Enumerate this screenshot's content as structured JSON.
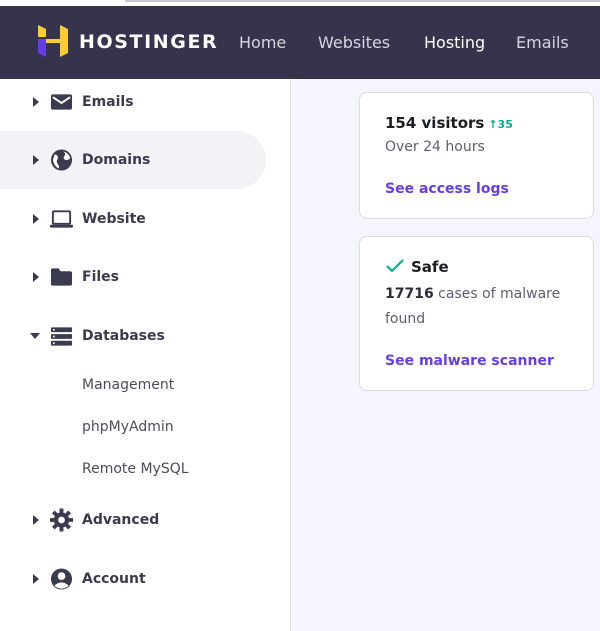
{
  "header": {
    "brand": "HOSTINGER",
    "nav": [
      "Home",
      "Websites",
      "Hosting",
      "Emails"
    ],
    "active_nav": "Hosting",
    "colors": {
      "background": "#36344d",
      "logo_primary": "#ffcd33",
      "logo_accent": "#673de6"
    }
  },
  "sidebar": {
    "items": [
      {
        "label": "Emails",
        "icon": "envelope-icon"
      },
      {
        "label": "Domains",
        "icon": "globe-icon"
      },
      {
        "label": "Website",
        "icon": "laptop-icon"
      },
      {
        "label": "Files",
        "icon": "folder-icon"
      },
      {
        "label": "Databases",
        "icon": "database-icon",
        "expanded": true,
        "children": [
          "Management",
          "phpMyAdmin",
          "Remote MySQL"
        ]
      },
      {
        "label": "Advanced",
        "icon": "gear-icon"
      },
      {
        "label": "Account",
        "icon": "user-circle-icon"
      }
    ]
  },
  "cards": {
    "visitors": {
      "title": "154 visitors",
      "delta": "35",
      "subtitle": "Over 24 hours",
      "link": "See access logs"
    },
    "security": {
      "title": "Safe",
      "count": "17716",
      "subtitle_rest": "cases of malware found",
      "link": "See malware scanner"
    }
  },
  "colors": {
    "accent": "#673de6",
    "positive": "#00b090"
  }
}
